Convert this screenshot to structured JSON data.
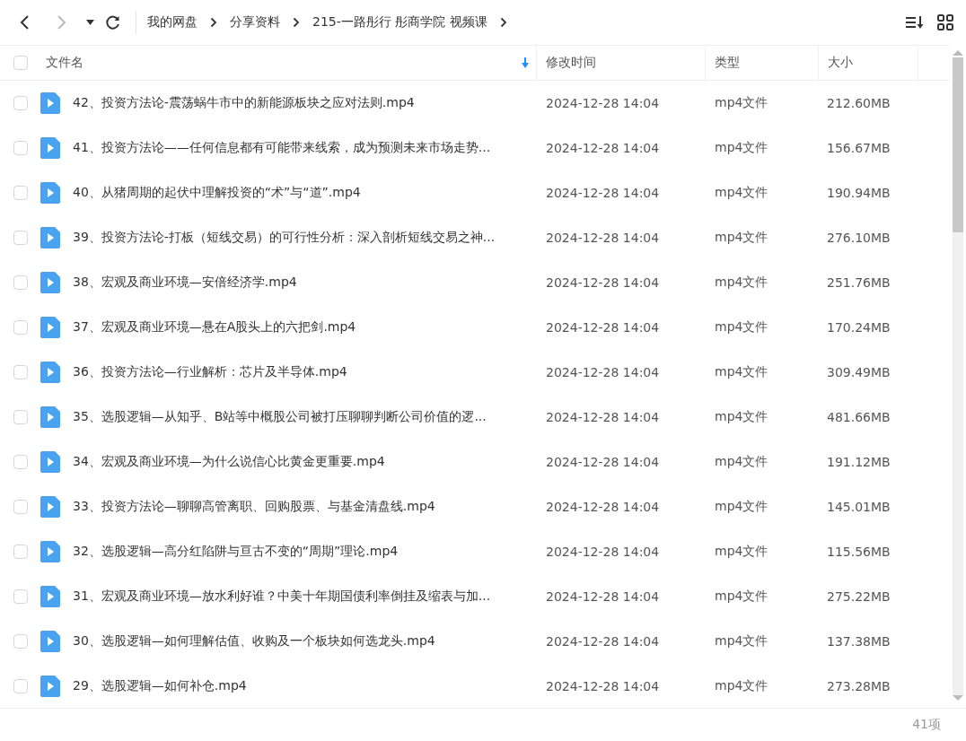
{
  "nav": {
    "back_disabled": false,
    "forward_disabled": true
  },
  "breadcrumb": [
    "我的网盘",
    "分享资料",
    "215-一路彤行 彤商学院 视频课"
  ],
  "table": {
    "select_all": {
      "checked": false
    },
    "columns": [
      {
        "label": "文件名",
        "sorted": true
      },
      {
        "label": "修改时间",
        "sorted": false
      },
      {
        "label": "类型",
        "sorted": false
      },
      {
        "label": "大小",
        "sorted": false
      }
    ],
    "rows": [
      {
        "checked": false,
        "name": "42、投资方法论-震荡蜗牛市中的新能源板块之应对法则.mp4",
        "modified": "2024-12-28 14:04",
        "type": "mp4文件",
        "size": "212.60MB"
      },
      {
        "checked": false,
        "name": "41、投资方法论——任何信息都有可能带来线索，成为预测未来市场走势...",
        "modified": "2024-12-28 14:04",
        "type": "mp4文件",
        "size": "156.67MB"
      },
      {
        "checked": false,
        "name": "40、从猪周期的起伏中理解投资的“术”与“道”.mp4",
        "modified": "2024-12-28 14:04",
        "type": "mp4文件",
        "size": "190.94MB"
      },
      {
        "checked": false,
        "name": "39、投资方法论-打板（短线交易）的可行性分析：深入剖析短线交易之神...",
        "modified": "2024-12-28 14:04",
        "type": "mp4文件",
        "size": "276.10MB"
      },
      {
        "checked": false,
        "name": "38、宏观及商业环境—安倍经济学.mp4",
        "modified": "2024-12-28 14:04",
        "type": "mp4文件",
        "size": "251.76MB"
      },
      {
        "checked": false,
        "name": "37、宏观及商业环境—悬在A股头上的六把剑.mp4",
        "modified": "2024-12-28 14:04",
        "type": "mp4文件",
        "size": "170.24MB"
      },
      {
        "checked": false,
        "name": "36、投资方法论—行业解析：芯片及半导体.mp4",
        "modified": "2024-12-28 14:04",
        "type": "mp4文件",
        "size": "309.49MB"
      },
      {
        "checked": false,
        "name": "35、选股逻辑—从知乎、B站等中概股公司被打压聊聊判断公司价值的逻...",
        "modified": "2024-12-28 14:04",
        "type": "mp4文件",
        "size": "481.66MB"
      },
      {
        "checked": false,
        "name": "34、宏观及商业环境—为什么说信心比黄金更重要.mp4",
        "modified": "2024-12-28 14:04",
        "type": "mp4文件",
        "size": "191.12MB"
      },
      {
        "checked": false,
        "name": "33、投资方法论—聊聊高管离职、回购股票、与基金清盘线.mp4",
        "modified": "2024-12-28 14:04",
        "type": "mp4文件",
        "size": "145.01MB"
      },
      {
        "checked": false,
        "name": "32、选股逻辑—高分红陷阱与亘古不变的“周期”理论.mp4",
        "modified": "2024-12-28 14:04",
        "type": "mp4文件",
        "size": "115.56MB"
      },
      {
        "checked": false,
        "name": "31、宏观及商业环境—放水利好谁？中美十年期国债利率倒挂及缩表与加...",
        "modified": "2024-12-28 14:04",
        "type": "mp4文件",
        "size": "275.22MB"
      },
      {
        "checked": false,
        "name": "30、选股逻辑—如何理解估值、收购及一个板块如何选龙头.mp4",
        "modified": "2024-12-28 14:04",
        "type": "mp4文件",
        "size": "137.38MB"
      },
      {
        "checked": false,
        "name": "29、选股逻辑—如何补仓.mp4",
        "modified": "2024-12-28 14:04",
        "type": "mp4文件",
        "size": "273.28MB"
      }
    ]
  },
  "status_bar": {
    "count": "41项"
  }
}
